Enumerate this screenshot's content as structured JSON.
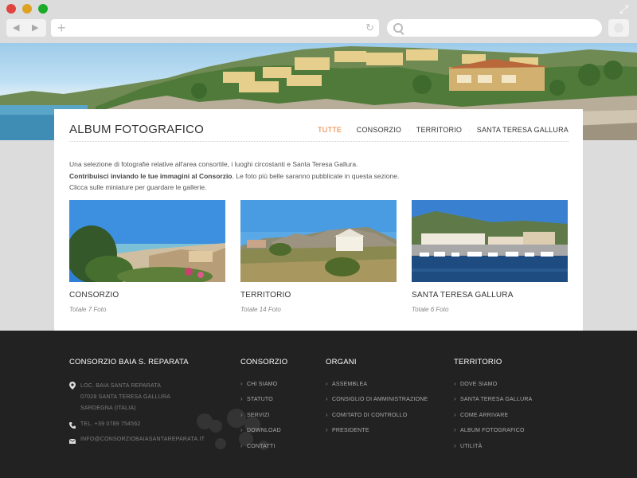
{
  "browser": {
    "back_icon": "back-arrow-icon",
    "forward_icon": "forward-arrow-icon",
    "url": "",
    "search_placeholder": ""
  },
  "page": {
    "title": "ALBUM FOTOGRAFICO",
    "filters": [
      {
        "label": "TUTTE",
        "active": true
      },
      {
        "label": "CONSORZIO",
        "active": false
      },
      {
        "label": "TERRITORIO",
        "active": false
      },
      {
        "label": "SANTA TERESA GALLURA",
        "active": false
      }
    ],
    "intro": {
      "line1": "Una selezione di fotografie relative all'area consortile, i luoghi circostanti e Santa Teresa Gallura.",
      "line2_bold": "Contribuisci inviando le tue immagini al Consorzio",
      "line2_rest": ". Le foto più belle saranno pubblicate in questa sezione.",
      "line3": "Clicca sulle miniature per guardare le gallerie."
    },
    "galleries": [
      {
        "title": "CONSORZIO",
        "count": "Totale 7 Foto"
      },
      {
        "title": "TERRITORIO",
        "count": "Totale 14 Foto"
      },
      {
        "title": "SANTA TERESA GALLURA",
        "count": "Totale 6 Foto"
      }
    ]
  },
  "footer": {
    "col1": {
      "heading": "CONSORZIO BAIA S. REPARATA",
      "address1": "LOC. BAIA SANTA REPARATA",
      "address2": "07028 SANTA TERESA GALLURA",
      "address3": "SARDEGNA (ITALIA)",
      "phone": "TEL. +39 0789 754562",
      "email": "INFO@CONSORZIOBAIASANTAREPARATA.IT"
    },
    "col2": {
      "heading": "CONSORZIO",
      "items": [
        "CHI SIAMO",
        "STATUTO",
        "SERVIZI",
        "DOWNLOAD",
        "CONTATTI"
      ]
    },
    "col3": {
      "heading": "ORGANI",
      "items": [
        "ASSEMBLEA",
        "CONSIGLIO DI AMMINISTRAZIONE",
        "COMITATO DI CONTROLLO",
        "PRESIDENTE"
      ]
    },
    "col4": {
      "heading": "TERRITORIO",
      "items": [
        "DOVE SIAMO",
        "SANTA TERESA GALLURA",
        "COME ARRIVARE",
        "ALBUM FOTOGRAFICO",
        "UTILITÀ"
      ]
    }
  },
  "colors": {
    "accent": "#e8782c",
    "footer_bg": "#222222",
    "chrome_bg": "#dcdcdc"
  }
}
